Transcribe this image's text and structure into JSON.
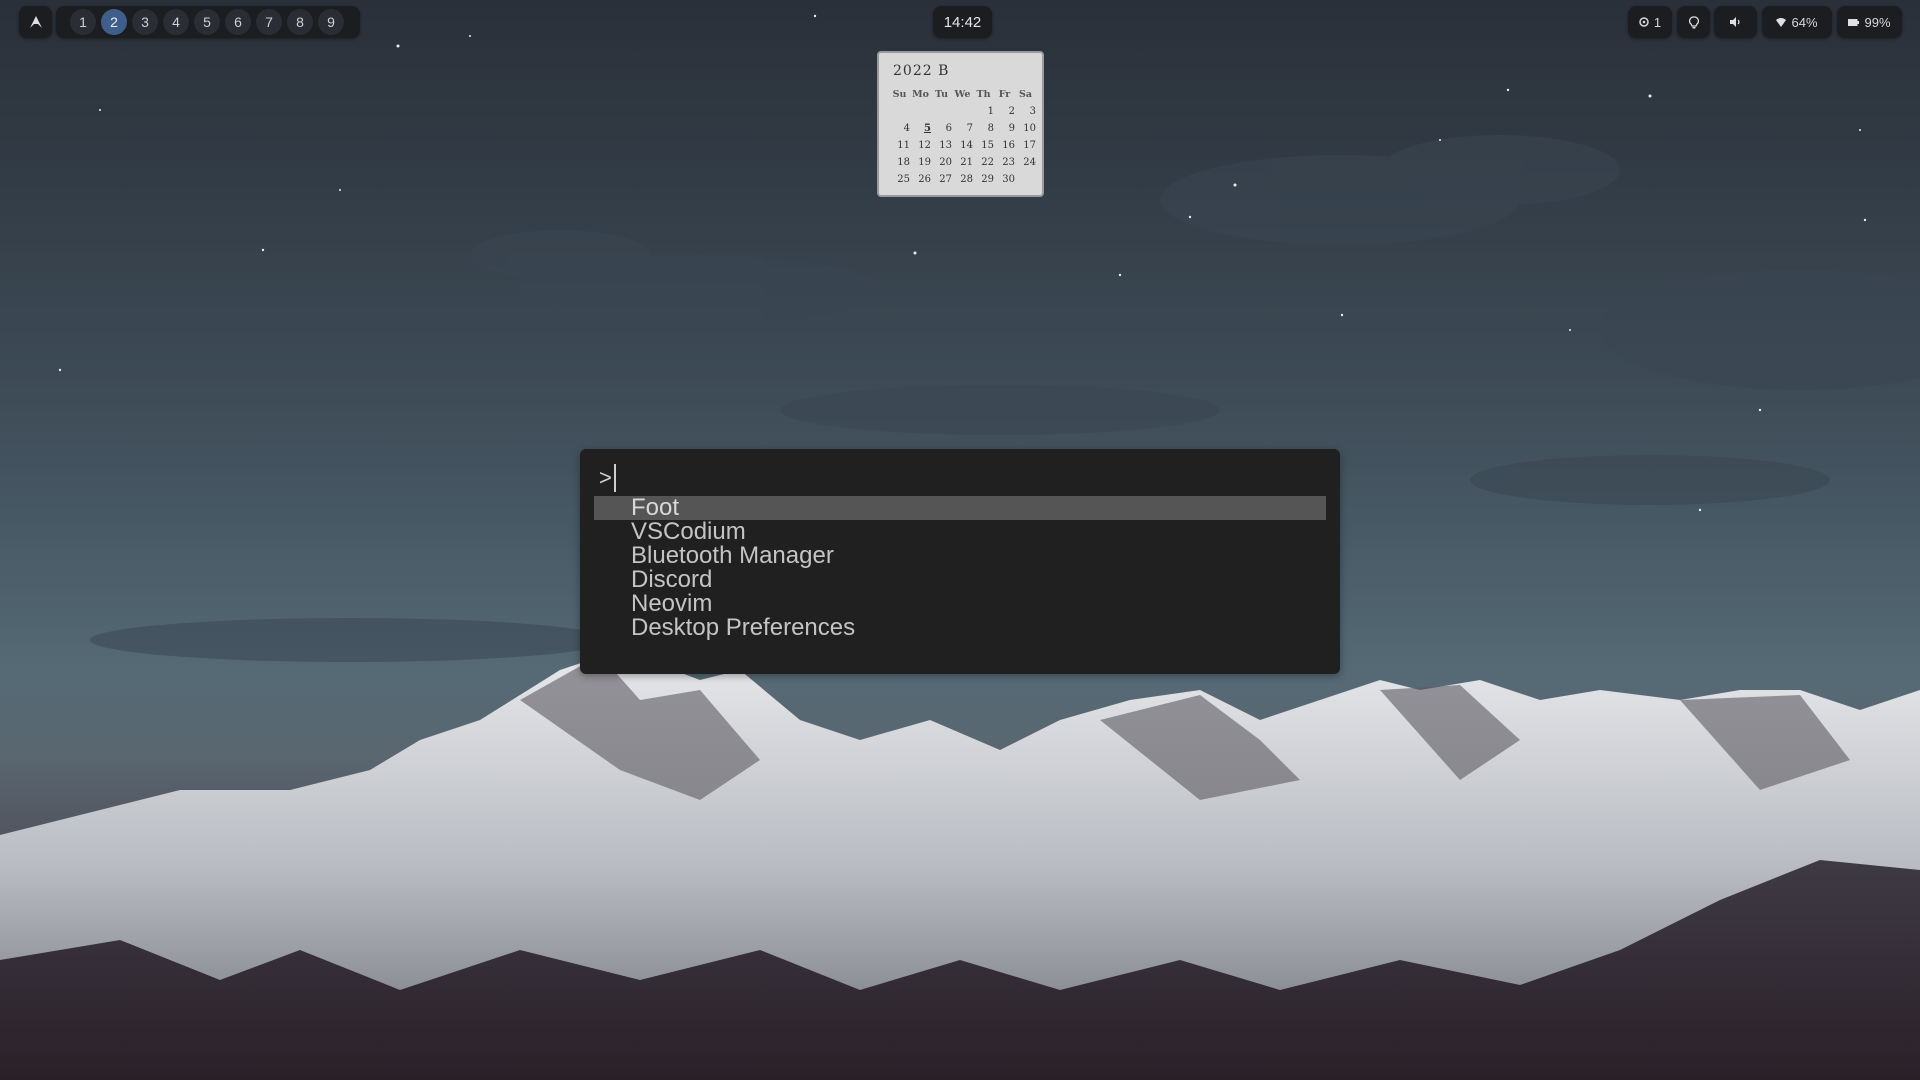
{
  "topbar": {
    "launcher_icon": "arch-logo-icon",
    "workspaces": [
      "1",
      "2",
      "3",
      "4",
      "5",
      "6",
      "7",
      "8",
      "9"
    ],
    "active_workspace": "2",
    "clock": "14:42",
    "notifications": {
      "icon": "notification-icon",
      "count": "1"
    },
    "brightness_icon": "bulb-icon",
    "volume_icon": "volume-icon",
    "wifi": {
      "icon": "wifi-icon",
      "value": "64%"
    },
    "battery": {
      "icon": "battery-icon",
      "value": "99%"
    }
  },
  "calendar": {
    "title": "2022 В",
    "weekdays": [
      "Su",
      "Mo",
      "Tu",
      "We",
      "Th",
      "Fr",
      "Sa"
    ],
    "weeks": [
      [
        "",
        "",
        "",
        "",
        "1",
        "2",
        "3"
      ],
      [
        "4",
        "5",
        "6",
        "7",
        "8",
        "9",
        "10"
      ],
      [
        "11",
        "12",
        "13",
        "14",
        "15",
        "16",
        "17"
      ],
      [
        "18",
        "19",
        "20",
        "21",
        "22",
        "23",
        "24"
      ],
      [
        "25",
        "26",
        "27",
        "28",
        "29",
        "30",
        ""
      ]
    ],
    "today": "5"
  },
  "launcher": {
    "prompt": ">",
    "query": "",
    "results": [
      "Foot",
      "VSCodium",
      "Bluetooth Manager",
      "Discord",
      "Neovim",
      "Desktop Preferences"
    ],
    "selected": "Foot"
  },
  "colors": {
    "bar_bg": "#1b1d21",
    "workspace_active": "#3f5f8a",
    "runner_bg": "#202020",
    "runner_selected": "#555555",
    "calendar_bg": "#d9d9d9"
  }
}
